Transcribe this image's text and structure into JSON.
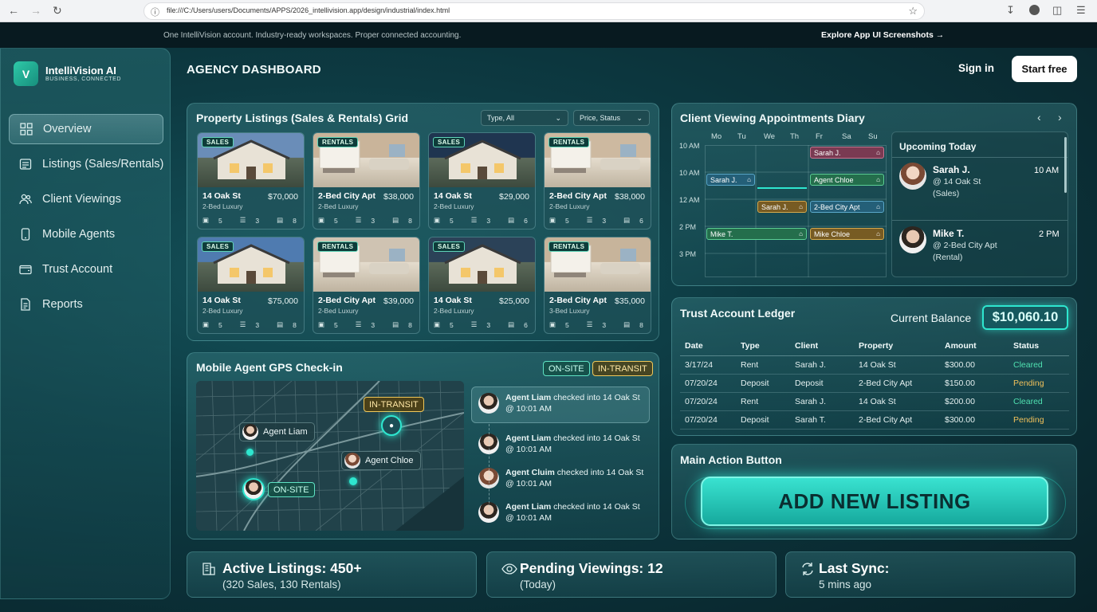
{
  "browser": {
    "url": "file:///C:/Users/users/Documents/APPS/2026_intellivision.app/design/industrial/index.html"
  },
  "strip": {
    "left": "One IntelliVision account. Industry-ready workspaces. Proper connected accounting.",
    "right": "Explore App UI Screenshots →"
  },
  "brand": {
    "letter": "V",
    "name": "IntelliVision AI",
    "tagline": "BUSINESS, CONNECTED"
  },
  "sidebar": {
    "items": [
      {
        "label": "Overview",
        "icon": "grid-icon"
      },
      {
        "label": "Listings (Sales/Rentals)",
        "icon": "listing-icon"
      },
      {
        "label": "Client Viewings",
        "icon": "users-icon"
      },
      {
        "label": "Mobile Agents",
        "icon": "phone-icon"
      },
      {
        "label": "Trust Account",
        "icon": "wallet-icon"
      },
      {
        "label": "Reports",
        "icon": "report-icon"
      }
    ]
  },
  "header": {
    "title": "AGENCY DASHBOARD",
    "signin": "Sign in",
    "start": "Start free"
  },
  "listings": {
    "title": "Property Listings (Sales & Rentals) Grid",
    "filter_type": "Type, All",
    "filter_price": "Price, Status",
    "cards": [
      {
        "badge": "SALES",
        "title": "14 Oak St",
        "price": "$70,000",
        "sub": "2-Bed Luxury",
        "beds": "5",
        "baths": "3",
        "cars": "8"
      },
      {
        "badge": "RENTALS",
        "title": "2-Bed City Apt",
        "price": "$38,000",
        "sub": "2-Bed Luxury",
        "beds": "5",
        "baths": "3",
        "cars": "8"
      },
      {
        "badge": "SALES",
        "title": "14 Oak St",
        "price": "$29,000",
        "sub": "2-Bed Luxury",
        "beds": "5",
        "baths": "3",
        "cars": "6"
      },
      {
        "badge": "RENTALS",
        "title": "2-Bed City Apt",
        "price": "$38,000",
        "sub": "2-Bed Luxury",
        "beds": "5",
        "baths": "3",
        "cars": "6"
      },
      {
        "badge": "SALES",
        "title": "14 Oak St",
        "price": "$75,000",
        "sub": "2-Bed Luxury",
        "beds": "5",
        "baths": "3",
        "cars": "8"
      },
      {
        "badge": "RENTALS",
        "title": "2-Bed City Apt",
        "price": "$39,000",
        "sub": "2-Bed Luxury",
        "beds": "5",
        "baths": "3",
        "cars": "8"
      },
      {
        "badge": "SALES",
        "title": "14 Oak St",
        "price": "$25,000",
        "sub": "2-Bed Luxury",
        "beds": "5",
        "baths": "3",
        "cars": "6"
      },
      {
        "badge": "RENTALS",
        "title": "2-Bed City Apt",
        "price": "$35,000",
        "sub": "3-Bed Luxury",
        "beds": "5",
        "baths": "3",
        "cars": "8"
      }
    ]
  },
  "diary": {
    "title": "Client Viewing Appointments Diary",
    "days": [
      "Mo",
      "Tu",
      "We",
      "Th",
      "Fr",
      "Sa",
      "Su"
    ],
    "times": [
      "10 AM",
      "10 AM",
      "12 AM",
      "2 PM",
      "3 PM"
    ],
    "events": [
      {
        "label": "Sarah J.",
        "color": "#8a3f57"
      },
      {
        "label": "Sarah J.",
        "color": "#2b6f8a"
      },
      {
        "label": "Agent Chloe",
        "color": "#2f8a5a"
      },
      {
        "label": "Sarah J.",
        "color": "#8a6a2a"
      },
      {
        "label": "2-Bed City Apt",
        "color": "#2b6f8a"
      },
      {
        "label": "Mike T.",
        "color": "#2f8a5a"
      },
      {
        "label": "Mike Chloe",
        "color": "#8a6a2a"
      }
    ],
    "upcoming_title": "Upcoming Today",
    "upcoming": [
      {
        "name": "Sarah J.",
        "line1": "@ 14 Oak St",
        "line2": "(Sales)",
        "time": "10 AM"
      },
      {
        "name": "Mike T.",
        "line1": "@ 2-Bed City Apt",
        "line2": "(Rental)",
        "time": "2 PM"
      }
    ]
  },
  "ledger": {
    "title": "Trust Account Ledger",
    "balance_label": "Current Balance",
    "balance": "$10,060.10",
    "headers": [
      "Date",
      "Type",
      "Client",
      "Property",
      "Amount",
      "Status"
    ],
    "rows": [
      [
        "3/17/24",
        "Rent",
        "Sarah J.",
        "14 Oak St",
        "$300.00",
        "Cleared"
      ],
      [
        "07/20/24",
        "Deposit",
        "Deposit",
        "2-Bed City Apt",
        "$150.00",
        "Pending"
      ],
      [
        "07/20/24",
        "Rent",
        "Sarah J.",
        "14 Oak St",
        "$200.00",
        "Cleared"
      ],
      [
        "07/20/24",
        "Deposit",
        "Sarah T.",
        "2-Bed City Apt",
        "$300.00",
        "Pending"
      ]
    ],
    "status_colors": {
      "Cleared": "#4fe0b0",
      "Pending": "#f0c05a"
    }
  },
  "gps": {
    "title": "Mobile Agent GPS Check-in",
    "onsite": "ON-SITE",
    "transit": "IN-TRANSIT",
    "map_labels": {
      "agent1": "Agent Liam",
      "agent2": "Agent Chloe",
      "onsite": "ON-SITE",
      "transit": "IN-TRANSIT"
    },
    "feed": [
      {
        "name": "Agent Liam",
        "text": " checked into ",
        "place": "14 Oak St",
        "time": "@ 10:01 AM"
      },
      {
        "name": "Agent Liam",
        "text": " checked into ",
        "place": "14 Oak St",
        "time": "@ 10:01 AM"
      },
      {
        "name": "Agent Cluim",
        "text": " checked into ",
        "place": "14 Oak St",
        "time": "@ 10:01 AM"
      },
      {
        "name": "Agent Liam",
        "text": " checked into ",
        "place": "14 Oak St",
        "time": "@ 10:01 AM"
      }
    ]
  },
  "action": {
    "title": "Main Action Button",
    "button": "ADD NEW LISTING"
  },
  "stats": [
    {
      "big": "Active Listings: 450+",
      "small": "(320 Sales, 130 Rentals)",
      "icon": "building-icon"
    },
    {
      "big": "Pending Viewings: 12",
      "small": "(Today)",
      "icon": "eye-icon"
    },
    {
      "big": "Last Sync:",
      "small": "5 mins ago",
      "icon": "sync-icon"
    }
  ],
  "colors": {
    "accent": "#2ee6cf",
    "brand": "#1fb596",
    "onsite": "#5fe3c4",
    "transit": "#f0c85a"
  }
}
